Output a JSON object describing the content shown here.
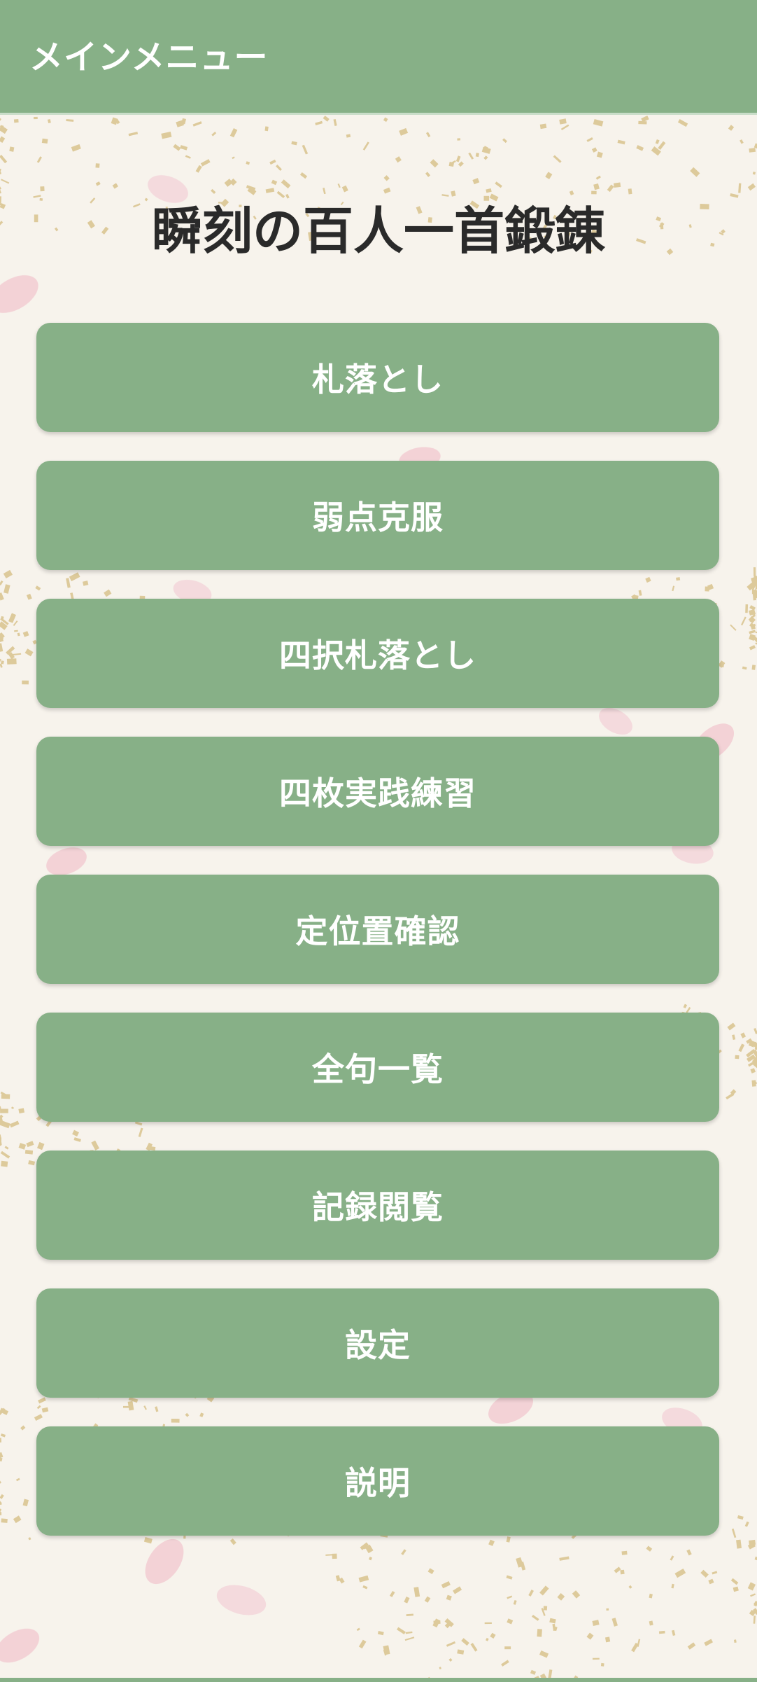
{
  "app_bar": {
    "title": "メインメニュー"
  },
  "app_title": "瞬刻の百人一首鍛錬",
  "menu": {
    "items": [
      {
        "label": "札落とし"
      },
      {
        "label": "弱点克服"
      },
      {
        "label": "四択札落とし"
      },
      {
        "label": "四枚実践練習"
      },
      {
        "label": "定位置確認"
      },
      {
        "label": "全句一覧"
      },
      {
        "label": "記録閲覧"
      },
      {
        "label": "設定"
      },
      {
        "label": "説明"
      }
    ]
  },
  "colors": {
    "primary_green": "#87b087",
    "background_paper": "#f7f3ec",
    "gold_leaf": "#c9a85a",
    "petal_pink": "#f2c7cf",
    "title_text": "#2a2a2a",
    "button_text": "#ffffff"
  }
}
